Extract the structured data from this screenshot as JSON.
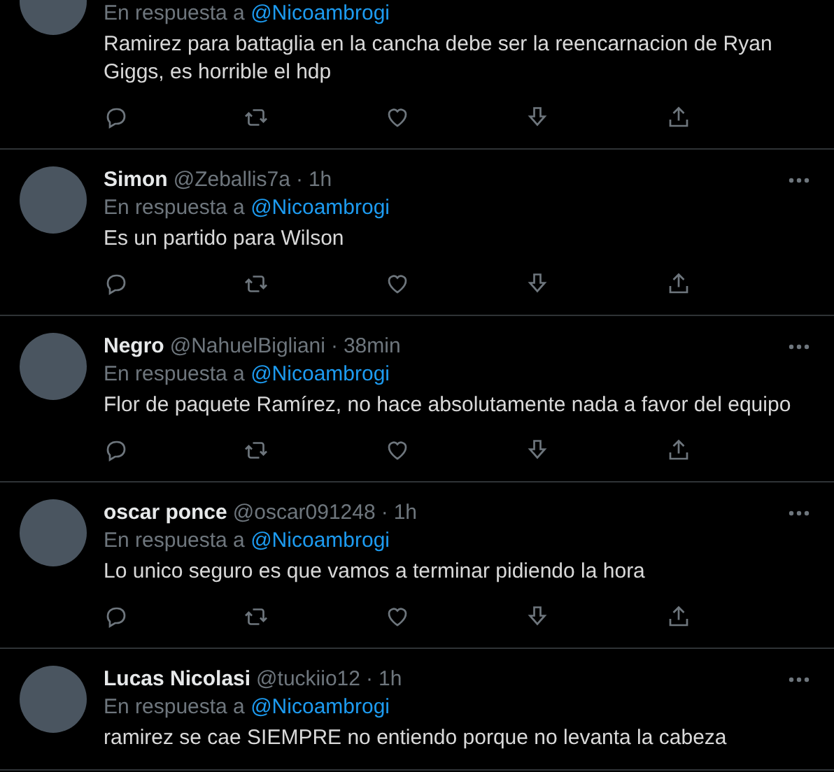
{
  "tweets": [
    {
      "reply_prefix": "En respuesta a",
      "reply_to": "@Nicoambrogi",
      "text": "Ramirez para battaglia en la cancha debe ser la reencarnacion de Ryan Giggs, es horrible el hdp",
      "actions": true
    },
    {
      "name": "Simon",
      "handle": "@Zeballis7a",
      "separator": "·",
      "time": "1h",
      "reply_prefix": "En respuesta a",
      "reply_to": "@Nicoambrogi",
      "text": "Es un partido para Wilson",
      "actions": true
    },
    {
      "name": "Negro",
      "handle": "@NahuelBigliani",
      "separator": "·",
      "time": "38min",
      "reply_prefix": "En respuesta a",
      "reply_to": "@Nicoambrogi",
      "text": "Flor de paquete Ramírez, no hace absolutamente nada a favor del equipo",
      "actions": true
    },
    {
      "name": "oscar ponce",
      "handle": "@oscar091248",
      "separator": "·",
      "time": "1h",
      "reply_prefix": "En respuesta a",
      "reply_to": "@Nicoambrogi",
      "text": "Lo unico seguro es que vamos a terminar pidiendo la hora",
      "actions": true
    },
    {
      "name": "Lucas Nicolasi",
      "handle": "@tuckiio12",
      "separator": "·",
      "time": "1h",
      "reply_prefix": "En respuesta a",
      "reply_to": "@Nicoambrogi",
      "text": "ramirez se cae SIEMPRE no entiendo porque no levanta la cabeza",
      "actions": false
    }
  ]
}
